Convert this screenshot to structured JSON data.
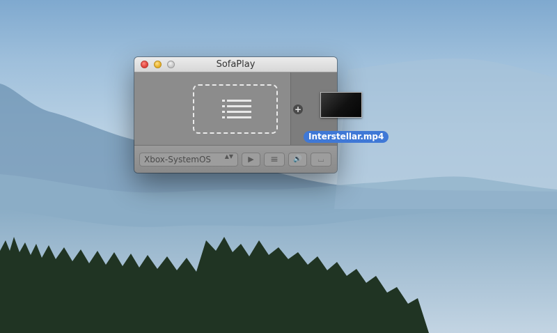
{
  "window": {
    "title": "SofaPlay"
  },
  "toolbar": {
    "device_select_value": "Xbox-SystemOS",
    "select_arrows": "▲▼",
    "play_glyph": "▶",
    "playlist_glyph": "≡",
    "volume_glyph": "🔊",
    "subtitles_glyph": "⌴"
  },
  "drag_item": {
    "file_name": "Interstellar.mp4",
    "add_glyph": "+"
  },
  "icons": {
    "close": "close-icon",
    "minimize": "minimize-icon",
    "zoom": "zoom-icon",
    "drop_zone": "list-icon",
    "add": "plus-icon",
    "play": "play-icon",
    "playlist": "playlist-icon",
    "volume": "volume-icon",
    "subtitles": "subtitles-icon"
  },
  "colors": {
    "selection_accent": "#3f78d6",
    "traffic_close": "#e0443e",
    "traffic_min": "#e8b22a"
  }
}
